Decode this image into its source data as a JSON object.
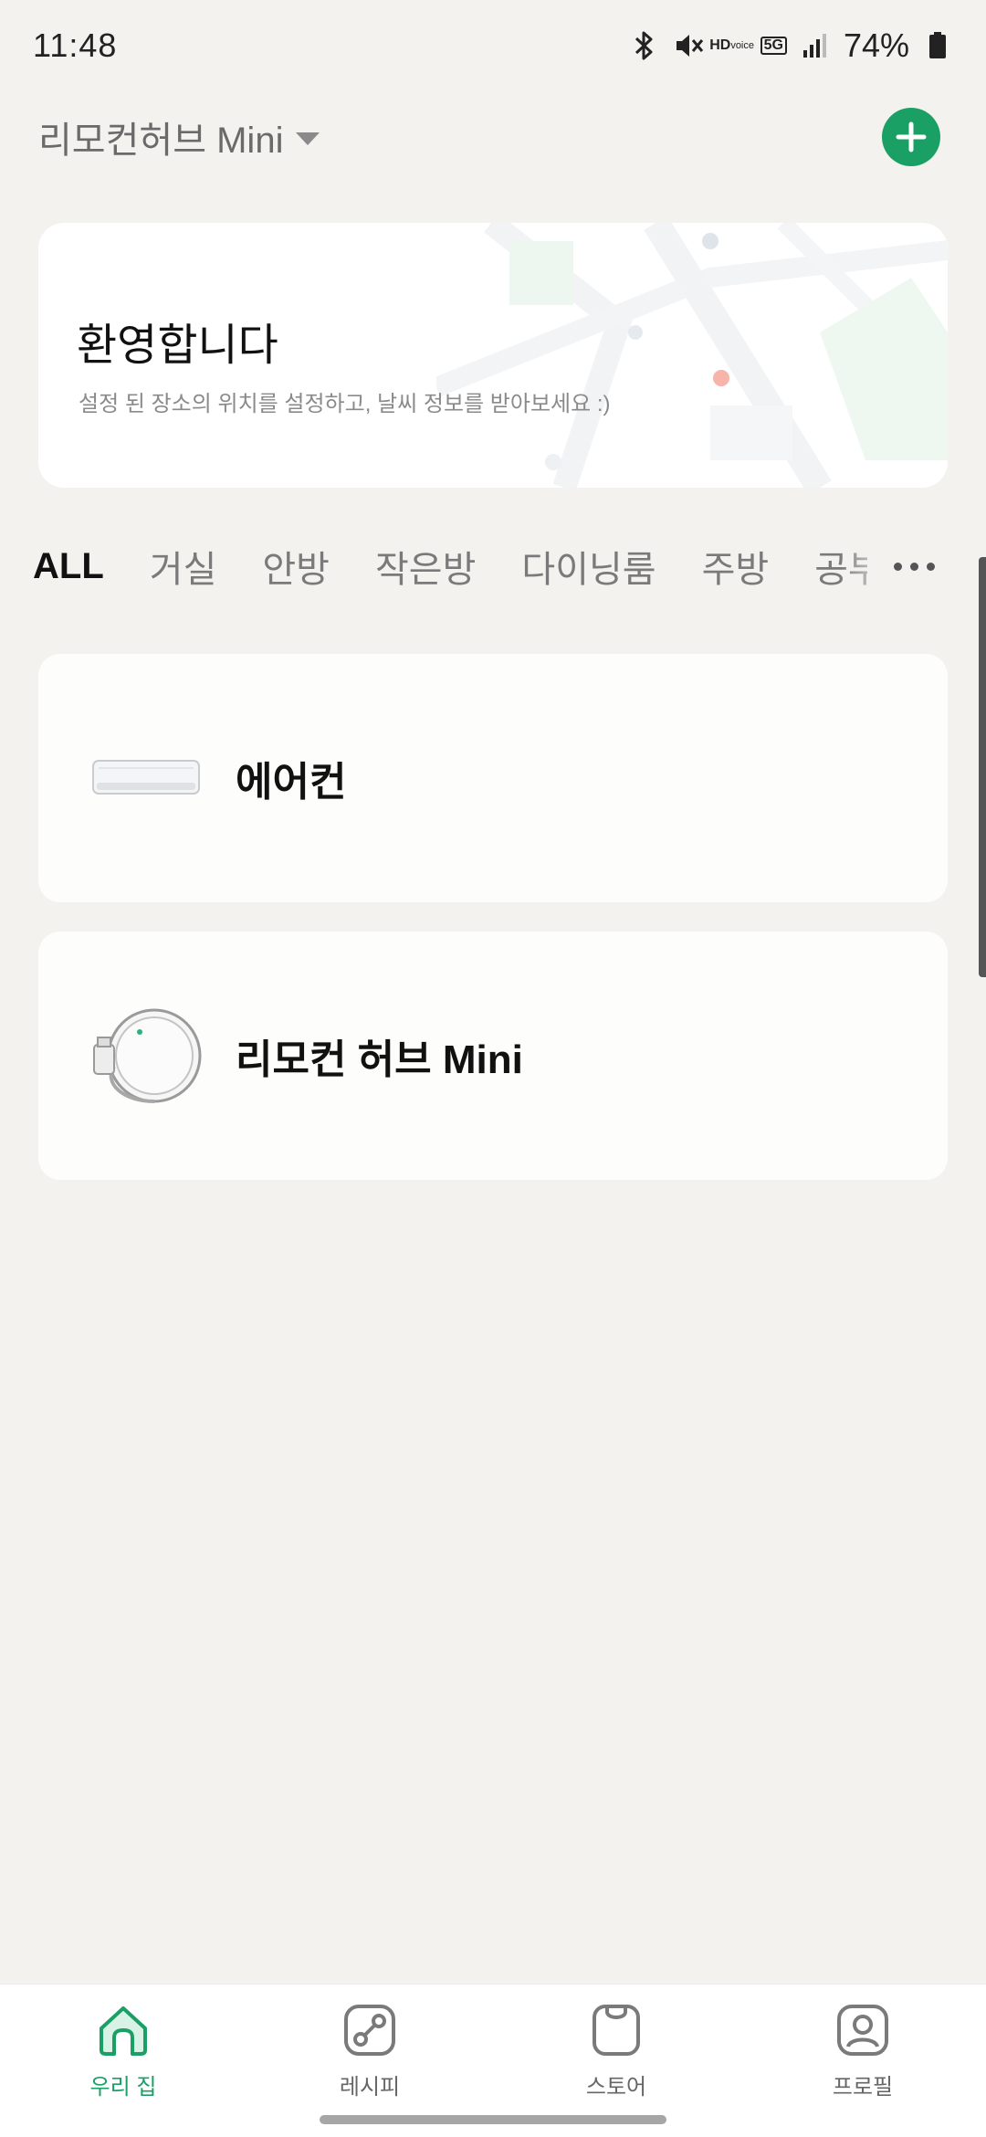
{
  "status_bar": {
    "time": "11:48",
    "hd_label": "HD",
    "hd_sub": "voice",
    "network": "5G",
    "battery": "74%"
  },
  "header": {
    "title": "리모컨허브 Mini"
  },
  "welcome": {
    "title": "환영합니다",
    "subtitle": "설정 된 장소의 위치를 설정하고, 날씨 정보를 받아보세요 :)"
  },
  "tabs": [
    {
      "label": "ALL"
    },
    {
      "label": "거실"
    },
    {
      "label": "안방"
    },
    {
      "label": "작은방"
    },
    {
      "label": "다이닝룸"
    },
    {
      "label": "주방"
    },
    {
      "label": "공부"
    }
  ],
  "devices": [
    {
      "name": "에어컨",
      "icon": "air-conditioner-icon"
    },
    {
      "name": "리모컨 허브 Mini",
      "icon": "remote-hub-mini-icon"
    }
  ],
  "bottom_nav": [
    {
      "label": "우리 집",
      "icon": "home-icon",
      "active": true
    },
    {
      "label": "레시피",
      "icon": "recipe-icon",
      "active": false
    },
    {
      "label": "스토어",
      "icon": "store-icon",
      "active": false
    },
    {
      "label": "프로필",
      "icon": "profile-icon",
      "active": false
    }
  ],
  "colors": {
    "accent": "#1aa065",
    "background": "#f4f2ef",
    "card": "#ffffff"
  }
}
